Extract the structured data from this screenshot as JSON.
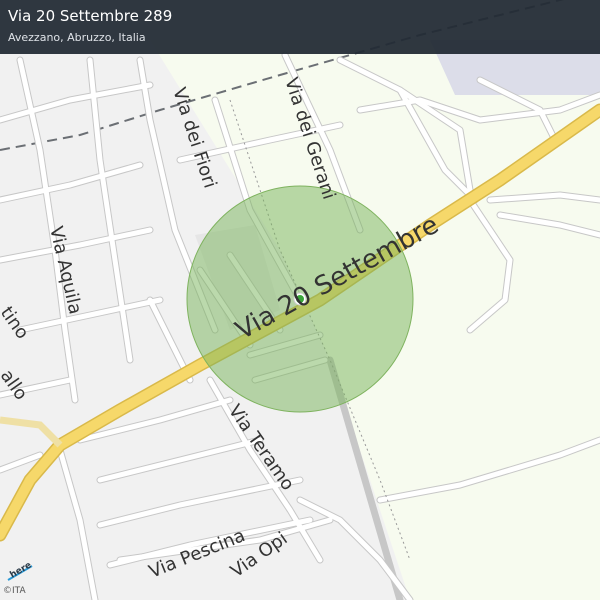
{
  "header": {
    "title": "Via 20 Settembre 289",
    "subtitle": "Avezzano, Abruzzo, Italia"
  },
  "streets": {
    "main": "Via 20 Settembre",
    "fiori": "Via dei Fiori",
    "gerani": "Via dei Gerani",
    "aquila": "Via Aquila",
    "teramo": "Via Teramo",
    "pescina": "Via Pescina",
    "opi": "Via Opi",
    "partial_left_1": "tino",
    "partial_left_2": "allo"
  },
  "attribution": {
    "logo_text": "here",
    "copyright": "©ITA"
  },
  "colors": {
    "background_urban": "#f1f1f1",
    "background_open": "#f7fbef",
    "main_road": "#f6d86a",
    "radius_fill": "#8fc16a",
    "pin": "#3aa53a",
    "header": "#222a34"
  },
  "marker": {
    "name": "location-pin"
  }
}
